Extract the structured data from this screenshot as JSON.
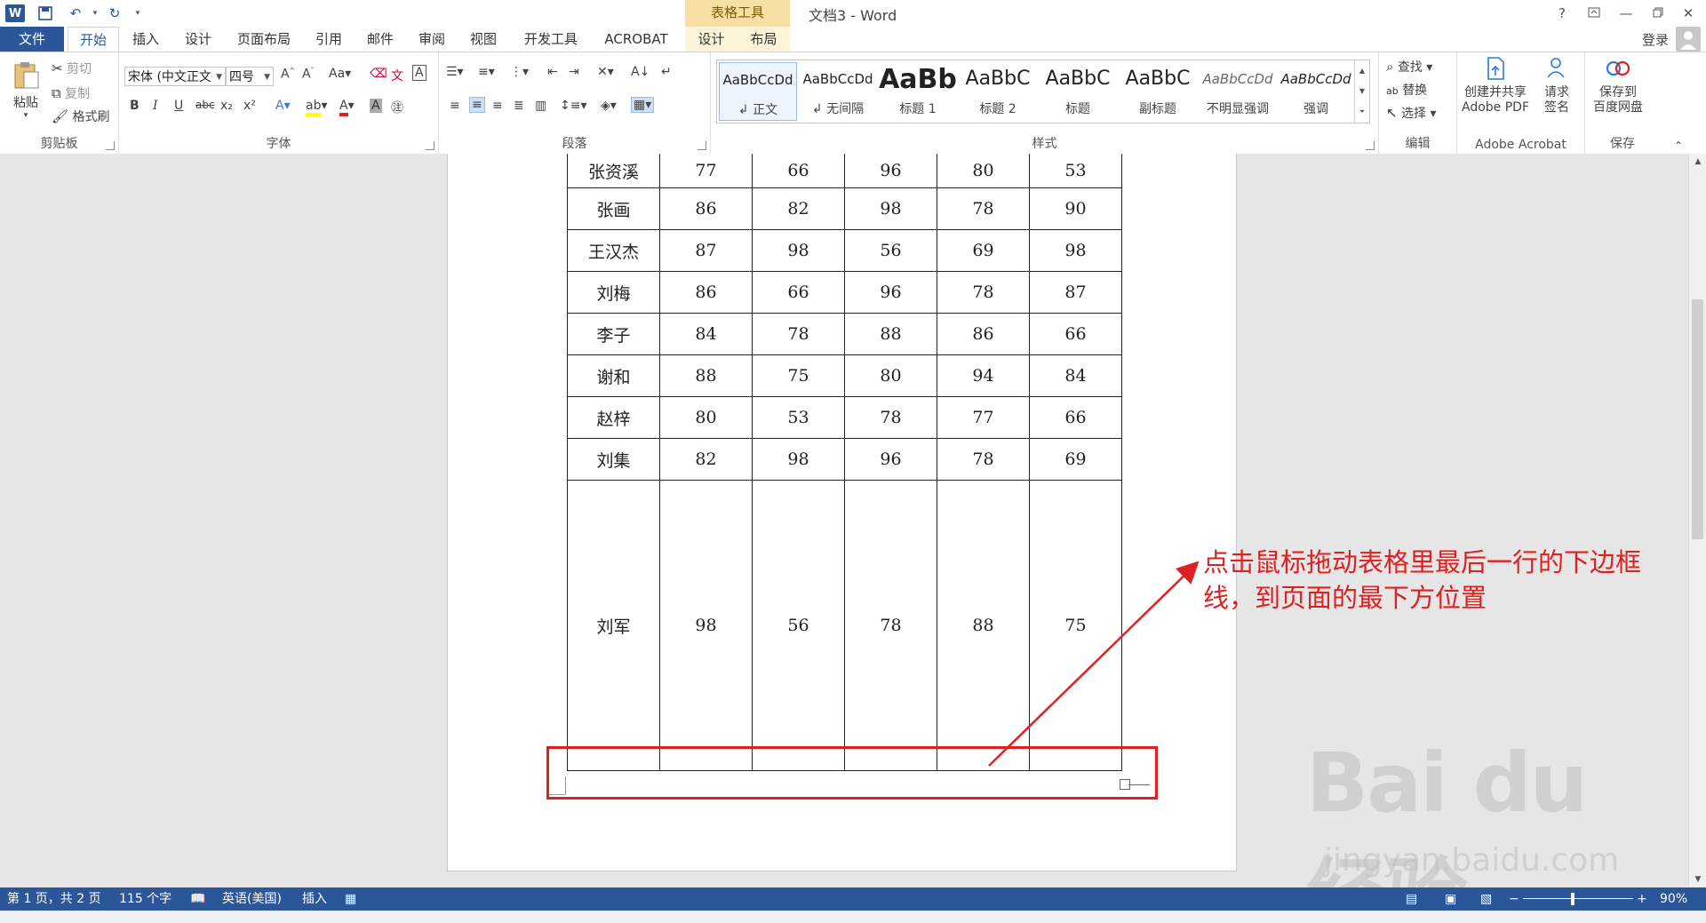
{
  "app": {
    "doc_title": "文档3 - Word",
    "context_tab_group": "表格工具",
    "login_label": "登录",
    "help_label": "?",
    "qat": {
      "undo_label": "↶",
      "redo_label": "↻"
    }
  },
  "tabs": [
    "文件",
    "开始",
    "插入",
    "设计",
    "页面布局",
    "引用",
    "邮件",
    "审阅",
    "视图",
    "开发工具",
    "ACROBAT",
    "设计",
    "布局"
  ],
  "ribbon": {
    "clipboard": {
      "label": "剪贴板",
      "paste": "粘贴",
      "cut": "剪切",
      "copy": "复制",
      "format_painter": "格式刷"
    },
    "font": {
      "label": "字体",
      "font_name": "宋体 (中文正文",
      "font_size": "四号",
      "bold": "B",
      "italic": "I",
      "underline": "U",
      "strike": "abc",
      "sub": "x₂",
      "sup": "x²"
    },
    "paragraph": {
      "label": "段落"
    },
    "styles": {
      "label": "样式",
      "items": [
        {
          "sample": "AaBbCcDd",
          "name": "↲ 正文"
        },
        {
          "sample": "AaBbCcDd",
          "name": "↲ 无间隔"
        },
        {
          "sample": "AaBb",
          "name": "标题 1"
        },
        {
          "sample": "AaBbC",
          "name": "标题 2"
        },
        {
          "sample": "AaBbC",
          "name": "标题"
        },
        {
          "sample": "AaBbC",
          "name": "副标题"
        },
        {
          "sample": "AaBbCcDd",
          "name": "不明显强调"
        },
        {
          "sample": "AaBbCcDd",
          "name": "强调"
        }
      ]
    },
    "editing": {
      "label": "编辑",
      "find": "查找",
      "replace": "替换",
      "select": "选择"
    },
    "acrobat": {
      "label": "Adobe Acrobat",
      "create_pdf_line1": "创建并共享",
      "create_pdf_line2": "Adobe PDF",
      "request_line1": "请求",
      "request_line2": "签名"
    },
    "save": {
      "label": "保存",
      "line1": "保存到",
      "line2": "百度网盘"
    }
  },
  "table": {
    "rows": [
      {
        "name": "张资溪",
        "scores": [
          "77",
          "66",
          "96",
          "80",
          "53"
        ]
      },
      {
        "name": "张画",
        "scores": [
          "86",
          "82",
          "98",
          "78",
          "90"
        ]
      },
      {
        "name": "王汉杰",
        "scores": [
          "87",
          "98",
          "56",
          "69",
          "98"
        ]
      },
      {
        "name": "刘梅",
        "scores": [
          "86",
          "66",
          "96",
          "78",
          "87"
        ]
      },
      {
        "name": "李子",
        "scores": [
          "84",
          "78",
          "88",
          "86",
          "66"
        ]
      },
      {
        "name": "谢和",
        "scores": [
          "88",
          "75",
          "80",
          "94",
          "84"
        ]
      },
      {
        "name": "赵梓",
        "scores": [
          "80",
          "53",
          "78",
          "77",
          "66"
        ]
      },
      {
        "name": "刘集",
        "scores": [
          "82",
          "98",
          "96",
          "78",
          "69"
        ]
      },
      {
        "name": "刘军",
        "scores": [
          "98",
          "56",
          "78",
          "88",
          "75"
        ]
      }
    ]
  },
  "annotation": {
    "text": "点击鼠标拖动表格里最后一行的下边框线，到页面的最下方位置",
    "color": "#e02020"
  },
  "watermark": {
    "main": "Bai du 经验",
    "sub": "jingyan.baidu.com"
  },
  "status": {
    "page": "第 1 页，共 2 页",
    "words": "115 个字",
    "language": "英语(美国)",
    "mode": "插入",
    "zoom": "90%"
  },
  "colors": {
    "accent": "#2b579a",
    "context_tab": "#f7dea3"
  }
}
